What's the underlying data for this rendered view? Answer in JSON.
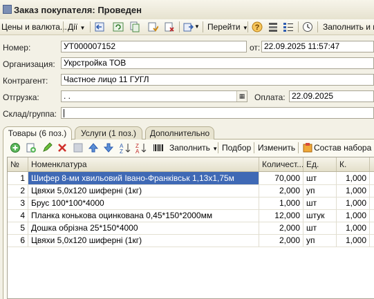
{
  "window": {
    "title": "Заказ покупателя: Проведен"
  },
  "toolbar": {
    "prices_label": "Цены и валюта...",
    "actions_label": "Дії",
    "go_label": "Перейти",
    "fill_print_label": "Заполнить и п"
  },
  "form": {
    "number_label": "Номер:",
    "number_value": "УТ000007152",
    "date_label": "от:",
    "date_value": "22.09.2025 11:57:47",
    "org_label": "Организация:",
    "org_value": "Укрстройка ТОВ",
    "contractor_label": "Контрагент:",
    "contractor_value": "Частное лицо 11 ГУГЛ",
    "shipment_label": "Отгрузка:",
    "shipment_value": " .  .",
    "payment_label": "Оплата:",
    "payment_value": "22.09.2025",
    "warehouse_label": "Склад/группа:",
    "warehouse_value": ""
  },
  "tabs": [
    {
      "label": "Товары (6 поз.)"
    },
    {
      "label": "Услуги (1 поз.)"
    },
    {
      "label": "Дополнительно"
    }
  ],
  "table_toolbar": {
    "fill_label": "Заполнить",
    "selection_label": "Подбор",
    "change_label": "Изменить",
    "set_label": "Состав набора"
  },
  "table": {
    "headers": {
      "no": "№",
      "item": "Номенклатура",
      "qty": "Количест...",
      "unit": "Ед.",
      "coef": "К."
    },
    "rows": [
      {
        "no": "1",
        "item": "Шифер 8-ми хвильовий Івано-Франківськ 1,13х1,75м",
        "qty": "70,000",
        "unit": "шт",
        "coef": "1,000"
      },
      {
        "no": "2",
        "item": "Цвяхи 5,0х120 шиферні (1кг)",
        "qty": "2,000",
        "unit": "уп",
        "coef": "1,000"
      },
      {
        "no": "3",
        "item": "Брус 100*100*4000",
        "qty": "1,000",
        "unit": "шт",
        "coef": "1,000"
      },
      {
        "no": "4",
        "item": "Планка конькова оцинкована 0,45*150*2000мм",
        "qty": "12,000",
        "unit": "штук",
        "coef": "1,000"
      },
      {
        "no": "5",
        "item": "Дошка обрізна 25*150*4000",
        "qty": "2,000",
        "unit": "шт",
        "coef": "1,000"
      },
      {
        "no": "6",
        "item": "Цвяхи 5,0х120 шиферні (1кг)",
        "qty": "2,000",
        "unit": "уп",
        "coef": "1,000"
      }
    ]
  }
}
